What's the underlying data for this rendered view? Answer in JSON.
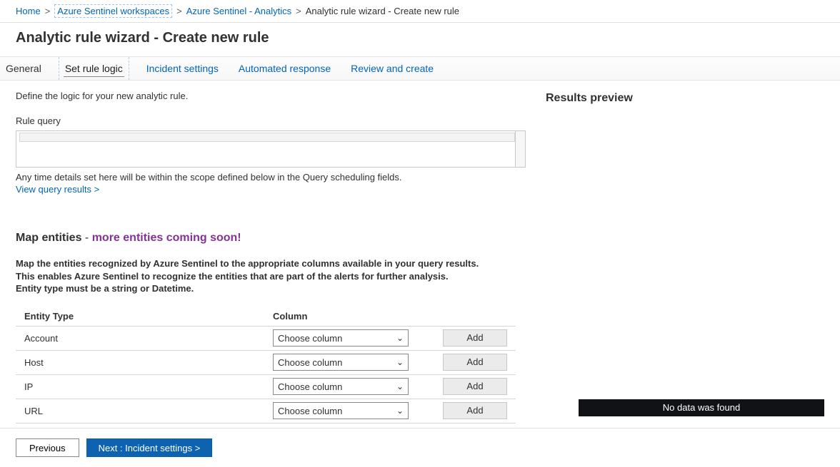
{
  "breadcrumb": {
    "home": "Home",
    "workspaces": "Azure Sentinel workspaces",
    "analytics": "Azure Sentinel - Analytics",
    "current": "Analytic rule wizard - Create new rule"
  },
  "page_title": "Analytic rule wizard - Create new rule",
  "tabs": {
    "general": "General",
    "set_rule_logic": "Set rule logic",
    "incident_settings": "Incident settings",
    "automated_response": "Automated response",
    "review_create": "Review and create"
  },
  "left": {
    "intro": "Define the logic for your new analytic rule.",
    "rule_query_label": "Rule query",
    "rule_query_help": "Any time details set here will be within the scope defined below in the Query scheduling fields.",
    "view_results": "View query results >",
    "map_heading_main": "Map entities",
    "map_heading_suffix": "more entities coming soon!",
    "map_desc_l1": "Map the entities recognized by Azure Sentinel to the appropriate columns available in your query results.",
    "map_desc_l2": "This enables Azure Sentinel to recognize the entities that are part of the alerts for further analysis.",
    "map_desc_l3": "Entity type must be a string or Datetime.",
    "th_type": "Entity Type",
    "th_column": "Column",
    "dropdown_placeholder": "Choose column",
    "add_label": "Add",
    "rows": {
      "r0": "Account",
      "r1": "Host",
      "r2": "IP",
      "r3": "URL"
    }
  },
  "right": {
    "heading": "Results preview",
    "no_data": "No data was found"
  },
  "footer": {
    "previous": "Previous",
    "next": "Next : Incident settings >"
  }
}
